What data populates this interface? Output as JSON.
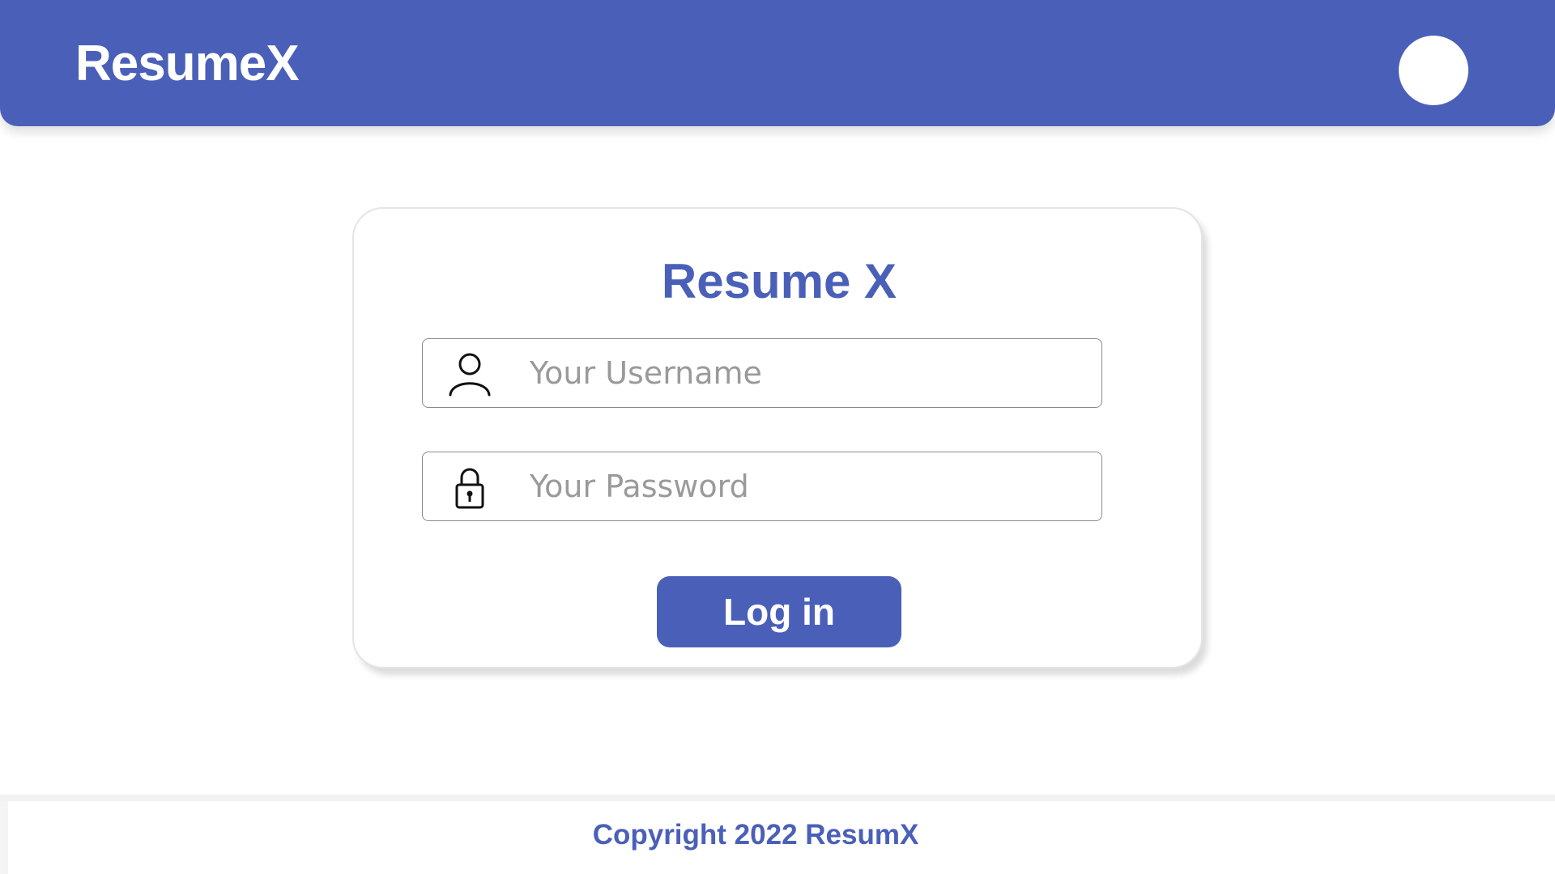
{
  "header": {
    "brand": "ResumeX",
    "avatar_icon": "user-avatar",
    "background_color": "#4a60b8"
  },
  "login_card": {
    "title": "Resume X",
    "username": {
      "icon": "person-icon",
      "placeholder": "Your Username",
      "value": ""
    },
    "password": {
      "icon": "lock-icon",
      "placeholder": "Your Password",
      "value": ""
    },
    "submit_label": "Log in"
  },
  "footer": {
    "copyright": "Copyright 2022 ResumX"
  },
  "colors": {
    "accent": "#4a60b8",
    "placeholder": "#9a9a9a"
  }
}
